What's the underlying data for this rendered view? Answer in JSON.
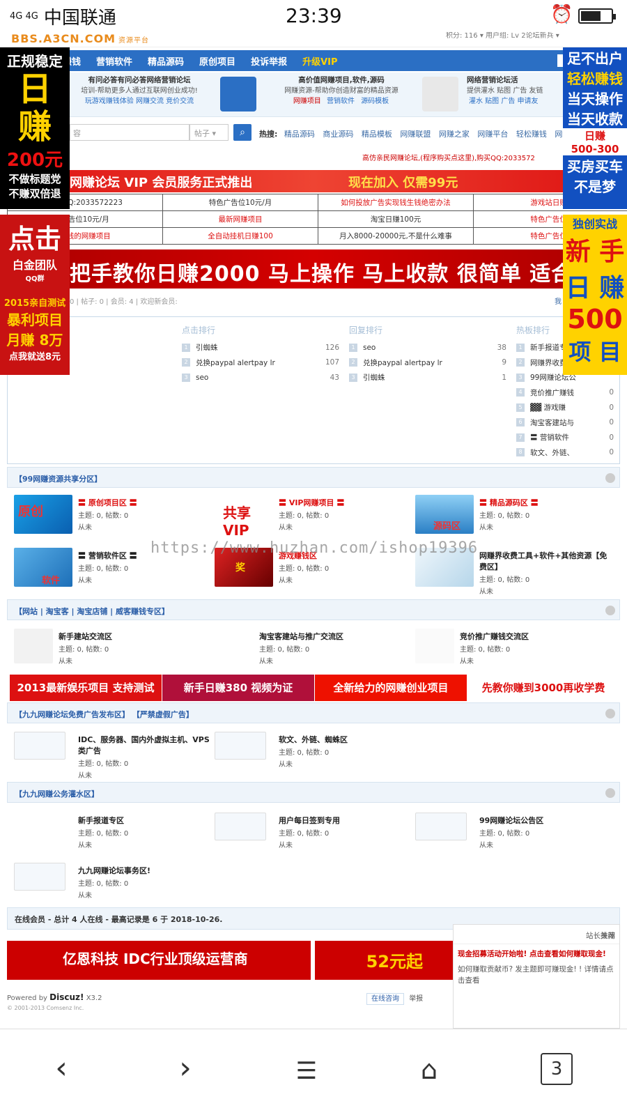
{
  "status": {
    "signal": "4G 4G",
    "carrier": "中国联通",
    "time": "23:39"
  },
  "header": {
    "logo": "BBS.A3CN.COM",
    "logo_sub": "资源平台",
    "userinfo": "积分: 116 ▾    用户组: Lv 2论坛新兵 ▾"
  },
  "nav": {
    "items": [
      "赚钱",
      "营销软件",
      "精品源码",
      "原创项目",
      "投诉举报"
    ],
    "vip": "升级VIP"
  },
  "promo": [
    {
      "title": "有问必答有问必答网络营销论坛",
      "line2": "培训-帮助更多人通过互联网创业成功!",
      "line3": "玩游戏赚钱体验  网赚交流  竞价交流"
    },
    {
      "title": "高价值网赚项目,软件,源码",
      "line2": "网赚资源-帮助你创造财富的精品资源",
      "links": [
        "网赚项目",
        "营销软件",
        "源码模板"
      ]
    },
    {
      "title": "网络营销论坛活",
      "line2": "提供灌水 贴图 广告 友链",
      "line3": "灌水  贴图  广告  申请友"
    }
  ],
  "search": {
    "placeholder": "容",
    "select": "帖子",
    "hot_label": "热搜:",
    "hot": [
      "精品源码",
      "商业源码",
      "精品模板",
      "网赚联盟",
      "网赚之家",
      "网赚平台",
      "轻松赚钱",
      "网络兼职"
    ]
  },
  "notice": "高仿亲民网赚论坛,(程序购买点这里),购买QQ:2033572",
  "vip_banner": {
    "left": "网赚论坛 VIP 会员服务正式推出",
    "right": "现在加入 仅需99元"
  },
  "ad_grid": [
    [
      "报名QQ:2033572223",
      "特色广告位10元/月",
      "如何投放广告实现钱生钱绝密办法",
      "游戏站日赚2"
    ],
    [
      "广告位10元/月",
      "最新网赚项目",
      "淘宝日赚100元",
      "特色广告位1"
    ],
    [
      "赚钱的网赚项目",
      "全自动挂机日赚100",
      "月入8000-20000元,不是什么难事",
      "特色广告位1"
    ]
  ],
  "big_banner": "把手教你日赚2000 马上操作 马上收款 很简单 适合",
  "stats": {
    "left": "0  |  帖子: 0  |  会员: 4  |  欢迎新会员:",
    "right": "我"
  },
  "ranks": {
    "click": {
      "title": "点击排行",
      "rows": [
        [
          "1",
          "引蜘蛛",
          "126"
        ],
        [
          "2",
          "兑换paypal alertpay lr",
          "107"
        ],
        [
          "3",
          "seo",
          "43"
        ]
      ]
    },
    "reply": {
      "title": "回复排行",
      "rows": [
        [
          "1",
          "seo",
          "38"
        ],
        [
          "2",
          "兑换paypal alertpay lr",
          "9"
        ],
        [
          "3",
          "引蜘蛛",
          "1"
        ]
      ]
    },
    "hot": {
      "title": "热板排行",
      "rows": [
        [
          "1",
          "新手报道专",
          ""
        ],
        [
          "2",
          "网赚界收费",
          ""
        ],
        [
          "3",
          "99网赚论坛公",
          ""
        ],
        [
          "4",
          "竞价推广赚钱",
          "0"
        ],
        [
          "5",
          "▓▓ 游戏赚",
          "0"
        ],
        [
          "6",
          "淘宝客建站与",
          "0"
        ],
        [
          "7",
          "〓 营销软件",
          "0"
        ],
        [
          "8",
          "软文、外链、",
          "0"
        ]
      ]
    }
  },
  "sections": {
    "s1": "【99网赚资源共享分区】",
    "s2": "【网站 | 淘宝客 | 淘宝店铺 | 威客赚钱专区】",
    "s3": "【九九网赚论坛免费广告发布区】 【严禁虚假广告】",
    "s4": "【九九网赚公务灌水区】"
  },
  "forums": {
    "f1": {
      "name": "〓 原创项目区 〓",
      "topics": "主题: 0, 帖数: 0",
      "last": "从未"
    },
    "f2": {
      "name": "〓 VIP网赚项目 〓",
      "topics": "主题: 0, 帖数: 0",
      "last": "从未"
    },
    "f3": {
      "name": "〓 精品源码区 〓",
      "topics": "主题: 0, 帖数: 0",
      "last": "从未"
    },
    "f4": {
      "name": "〓 营销软件区 〓",
      "topics": "主题: 0, 帖数: 0",
      "last": "从未"
    },
    "f5": {
      "name": "游戏赚钱区",
      "topics": "主题: 0, 帖数: 0",
      "last": "从未"
    },
    "f6": {
      "name": "网赚界收费工具+软件+其他资源【免费区】",
      "topics": "主题: 0, 帖数: 0",
      "last": "从未"
    },
    "f7": {
      "name": "新手建站交流区",
      "topics": "主题: 0, 帖数: 0",
      "last": "从未"
    },
    "f8": {
      "name": "淘宝客建站与推广交流区",
      "topics": "主题: 0, 帖数: 0",
      "last": "从未"
    },
    "f9": {
      "name": "竞价推广赚钱交流区",
      "topics": "主题: 0, 帖数: 0",
      "last": "从未"
    },
    "f10": {
      "name": "IDC、服务器、国内外虚拟主机、VPS类广告",
      "topics": "主题: 0, 帖数: 0",
      "last": "从未"
    },
    "f11": {
      "name": "软文、外链、蜘蛛区",
      "topics": "主题: 0, 帖数: 0",
      "last": "从未"
    },
    "f12": {
      "name": "新手报道专区",
      "topics": "主题: 0, 帖数: 0",
      "last": "从未"
    },
    "f13": {
      "name": "用户每日签到专用",
      "topics": "主题: 0, 帖数: 0",
      "last": "从未"
    },
    "f14": {
      "name": "99网赚论坛公告区",
      "topics": "主题: 0, 帖数: 0",
      "last": "从未"
    },
    "f15": {
      "name": "九九网赚论坛事务区!",
      "topics": "主题: 0, 帖数: 0",
      "last": "从未"
    }
  },
  "forum_icons": {
    "f1": "原创",
    "f2": "共享VIP",
    "f3": "源码区",
    "f4": "软件",
    "f5": "奖"
  },
  "watermark": "https://www.huzhan.com/ishop19396",
  "ad_strip": [
    "2013最新娱乐项目 支持测试",
    "新手日赚380  视频为证",
    "全新给力的网赚创业项目",
    "先教你赚到3000再收学费"
  ],
  "online": "在线会员 - 总计 4 人在线 - 最高记录是 6 于 2018-10-26.",
  "footer_ads": {
    "a": "亿恩科技  IDC行业顶级运营商",
    "b": "52元起"
  },
  "powered": {
    "label": "Powered by",
    "brand": "Discuz!",
    "ver": "X3.2",
    "copy": "© 2001-2013 Comsenz Inc."
  },
  "helpers": {
    "online_help": "在线咨询",
    "report": "举报"
  },
  "station": {
    "title": "站长推荐",
    "close": "关闭",
    "link": "现金招募活动开始啦! 点击查看如何赚取现金!",
    "text": "如何赚取贡献币? 发主题即可赚现金! ! 详情请点击查看"
  },
  "left_ads": {
    "a": [
      "正规稳定",
      "日",
      "赚",
      "200元",
      "不做标题党",
      "不赚双倍退"
    ],
    "b": [
      "点击",
      "白金团队",
      "QQ群",
      "2015亲自测试",
      "暴利项目",
      "月赚 8万",
      "点我就送8元"
    ]
  },
  "right_ads": {
    "a": [
      "足不出户",
      "轻松赚钱",
      "当天操作",
      "当天收款",
      "日赚",
      "500-300",
      "买房买车",
      "不是梦"
    ],
    "b": [
      "独创实战",
      "新 手",
      "日 赚",
      "500",
      "项 目"
    ]
  },
  "bottom_nav": {
    "tabs": "3"
  }
}
